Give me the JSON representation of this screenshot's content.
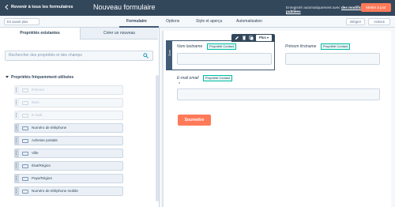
{
  "topbar": {
    "back_label": "Revenir à tous les formulaires",
    "title": "Nouveau formulaire",
    "autosave_text": "Enregistré automatiquement avec ",
    "autosave_link": "des modifications non publiées",
    "publish_label": "Mettre à jour"
  },
  "tabbar": {
    "left_dropdown": "En savoir plus",
    "tabs": [
      {
        "label": "Formulaire"
      },
      {
        "label": "Options"
      },
      {
        "label": "Style et aperçu"
      },
      {
        "label": "Automatisation"
      }
    ],
    "embed_label": "Intégrer",
    "actions_label": "Actions"
  },
  "left_panel": {
    "tabs": [
      {
        "label": "Propriétés existantes"
      },
      {
        "label": "Créer un nouveau"
      }
    ],
    "search_placeholder": "Rechercher des propriétés et des champs",
    "section_title": "Propriétés fréquemment utilisées",
    "properties": [
      {
        "label": "Prénom",
        "disabled": true
      },
      {
        "label": "Nom",
        "disabled": true
      },
      {
        "label": "E-mail",
        "disabled": true
      },
      {
        "label": "Numéro de téléphone",
        "disabled": false
      },
      {
        "label": "Adresse postale",
        "disabled": false
      },
      {
        "label": "Ville",
        "disabled": false
      },
      {
        "label": "État/Région",
        "disabled": false
      },
      {
        "label": "Pays/Région",
        "disabled": false
      },
      {
        "label": "Numéro de téléphone mobile",
        "disabled": false
      }
    ]
  },
  "canvas": {
    "strip_label": "Zone",
    "toolbar_more": "Plus",
    "fields": [
      {
        "label": "Nom lastname",
        "badge": "Propriété Contact"
      },
      {
        "label": "Prénom firstname",
        "badge": "Propriété Contact"
      },
      {
        "label": "E-mail email",
        "badge": "Propriété Contact",
        "required_mark": "*"
      }
    ],
    "submit_label": "Soumettre"
  },
  "colors": {
    "header_bg": "#33475b",
    "accent": "#ff7a59",
    "badge_border": "#00bda5"
  }
}
